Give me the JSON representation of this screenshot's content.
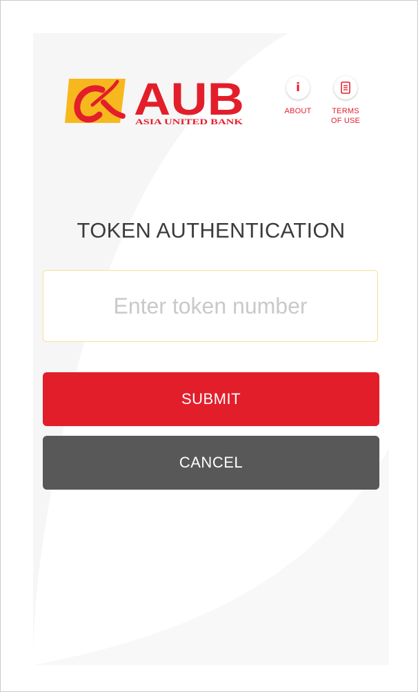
{
  "header": {
    "logo_text": "AUB",
    "logo_subtext": "ASIA UNITED BANK",
    "about": {
      "icon": "info-icon",
      "label": "ABOUT"
    },
    "terms": {
      "icon": "document-icon",
      "label_line1": "TERMS",
      "label_line2": "OF USE"
    }
  },
  "main": {
    "title": "TOKEN AUTHENTICATION",
    "token_input": {
      "value": "",
      "placeholder": "Enter token number"
    },
    "submit_label": "SUBMIT",
    "cancel_label": "CANCEL"
  },
  "colors": {
    "brand_red": "#e31e2b",
    "brand_yellow": "#f7b81e",
    "input_border": "#f6df96",
    "cancel_gray": "#585858"
  }
}
